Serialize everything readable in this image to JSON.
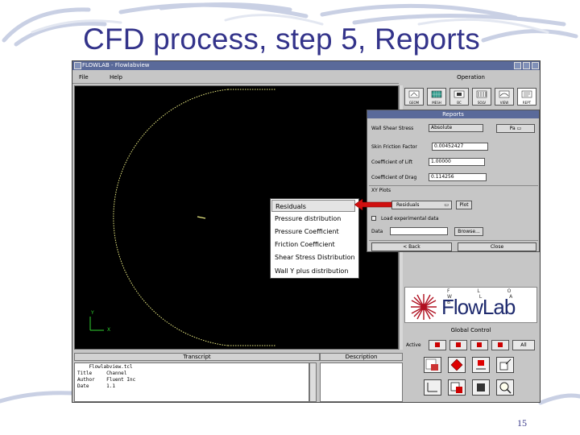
{
  "slide": {
    "title": "CFD process, step 5, Reports",
    "page_number": "15"
  },
  "app": {
    "window_title": "FLOWLAB - Flowlabview",
    "menu": [
      "File",
      "Help"
    ],
    "operation_label": "Operation",
    "operation_buttons": [
      "GEOM",
      "MESH",
      "BC",
      "SOLV",
      "VIEW",
      "REPT"
    ],
    "transcript": {
      "header": "Transcript",
      "lines": [
        "    Flowlabview.tcl",
        "Title     Channel",
        "Author    Fluent Inc",
        "Date      1.1"
      ]
    },
    "description": {
      "header": "Description"
    },
    "logo": {
      "text": "FlowLab",
      "strip": "F L O W L A B"
    },
    "global_control": {
      "label": "Global Control",
      "active_label": "Active",
      "all_label": "All"
    },
    "axis": {
      "y": "Y",
      "x": "X"
    }
  },
  "reports": {
    "title": "Reports",
    "wall_shear_label": "Wall Shear Stress",
    "wall_shear_value": "Absolute",
    "wall_shear_unit": "Pa",
    "skin_friction_label": "Skin Friction Factor",
    "skin_friction_value": "0.00452427",
    "lift_label": "Coefficient of Lift",
    "lift_value": "1.00000",
    "drag_label": "Coefficient of Drag",
    "drag_value": "0.114256",
    "xy_label": "XY Plots",
    "xy_select": "Residuals",
    "plot_button": "Plot",
    "experimental_label": "Load experimental data",
    "datafile_label": "Data",
    "datafile_value": "",
    "browse_button": "Browse...",
    "back_button": "< Back",
    "close_button": "Close"
  },
  "popup_menu": {
    "items": [
      "Residuals",
      "Pressure distribution",
      "Pressure Coefficient",
      "Friction Coefficient",
      "Shear Stress Distribution",
      "Wall Y plus distribution"
    ],
    "selected_index": 0
  },
  "colors": {
    "title_text": "#33338a",
    "titlebar": "#5a6a9a",
    "viewport_bg": "#000000",
    "geometry": "#e8e880",
    "arrow": "#d01010"
  }
}
